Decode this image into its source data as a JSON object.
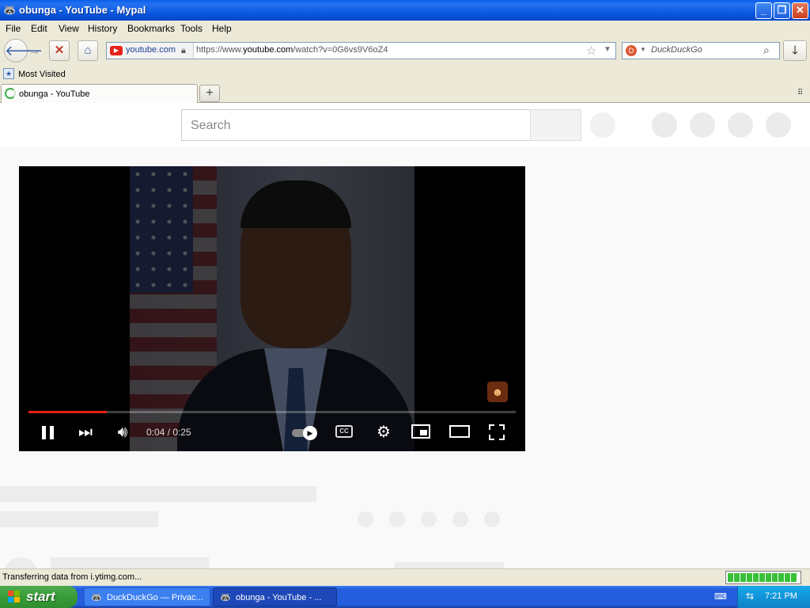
{
  "window": {
    "title": "obunga - YouTube - Mypal",
    "minimize": "_",
    "restore": "❐",
    "close": "✕"
  },
  "menu": [
    "File",
    "Edit",
    "View",
    "History",
    "Bookmarks",
    "Tools",
    "Help"
  ],
  "nav": {
    "identity_label": "youtube.com",
    "url_prefix": "https://www.",
    "url_domain": "youtube.com",
    "url_path": "/watch?v=0G6vs9V6oZ4",
    "search_placeholder": "DuckDuckGo",
    "search_engine_icon": "duckduckgo-icon"
  },
  "bookmarks": {
    "items": [
      {
        "label": "Most Visited",
        "icon": "bookmark-folder-icon"
      }
    ]
  },
  "tabs": [
    {
      "label": "obunga - YouTube",
      "state": "loading"
    }
  ],
  "page": {
    "search_placeholder": "Search",
    "player": {
      "time": "0:04 / 0:25",
      "progress_percent": 16,
      "autoplay": "on"
    }
  },
  "status": {
    "text": "Transferring data from i.ytimg.com...",
    "progress_segments": 11
  },
  "taskbar": {
    "start_label": "start",
    "items": [
      {
        "label": "DuckDuckGo — Privac...",
        "active": false
      },
      {
        "label": "obunga - YouTube - ...",
        "active": true
      }
    ],
    "clock": "7:21 PM"
  },
  "colors": {
    "youtube_red": "#e62117",
    "xp_blue": "#245edc",
    "start_green": "#379c37"
  }
}
